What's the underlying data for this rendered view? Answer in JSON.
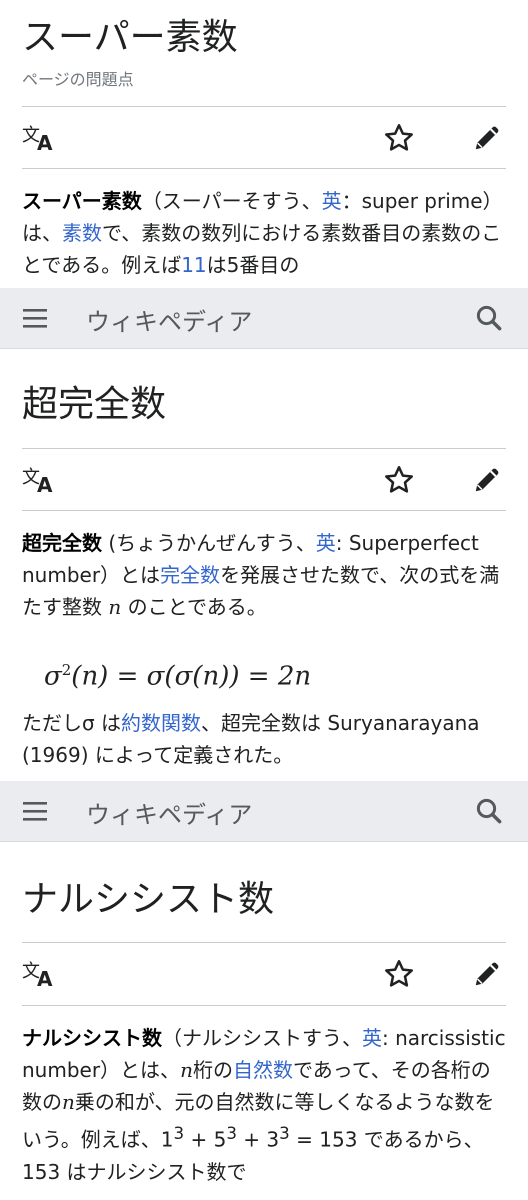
{
  "article1": {
    "title": "スーパー素数",
    "subtitle": "ページの問題点",
    "lead_term": "スーパー素数",
    "text_1": "（スーパーそすう、",
    "link_en": "英",
    "text_2": "：super prime）は、",
    "link_prime": "素数",
    "text_3": "で、素数の数列における素数番目の素数のことである。例えば",
    "link_11": "11",
    "text_4": "は5番目の"
  },
  "navbar": {
    "brand": "ウィキペディア"
  },
  "article2": {
    "title": "超完全数",
    "lead_term": "超完全数",
    "text_1": " (ちょうかんぜんすう、",
    "link_en": "英",
    "text_2": ": Superperfect number）とは",
    "link_perfect": "完全数",
    "text_3": "を発展させた数で、次の式を満たす整数 ",
    "var_n": "n",
    "text_4": " のことである。",
    "formula": {
      "sigma": "σ",
      "exp": "2",
      "arg": "(n)",
      "eq1": " = ",
      "nested": "σ(σ(n))",
      "eq2": " = ",
      "rhs": "2n"
    },
    "text_5": "ただしσ は",
    "link_divisor": "約数関数",
    "text_6": "、超完全数は Suryanarayana (1969) によって定義された。"
  },
  "article3": {
    "title": "ナルシシスト数",
    "lead_term": "ナルシシスト数",
    "text_1": "（ナルシシストすう、",
    "link_en": "英",
    "text_2": ": narcissistic number）とは、",
    "var_n": "n",
    "text_3": "桁の",
    "link_natural": "自然数",
    "text_4": "であって、その各桁の数の",
    "var_n2": "n",
    "text_5": "乗の和が、元の自然数に等しくなるような数をいう。例えば、1",
    "sup1": "3",
    "text_6": " + 5",
    "sup2": "3",
    "text_7": " + 3",
    "sup3": "3",
    "text_8": " = 153 であるから、153 はナルシシスト数で"
  },
  "icons": {
    "language": "language-icon",
    "star": "star-icon",
    "pencil": "pencil-icon",
    "menu": "menu-icon",
    "search": "search-icon"
  },
  "colors": {
    "link": "#3366cc",
    "navbar_bg": "#eaecf0",
    "icon": "#202122"
  }
}
